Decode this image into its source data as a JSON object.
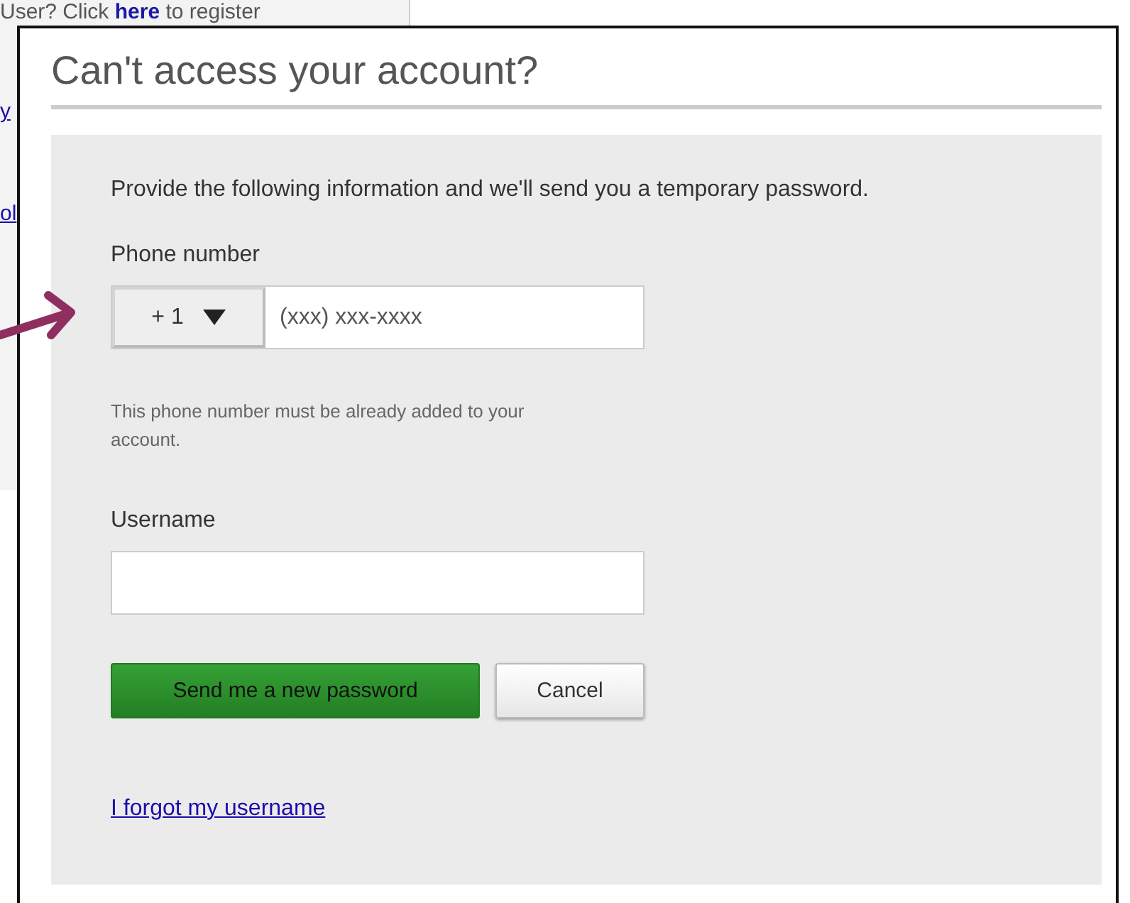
{
  "background_window": {
    "register_prompt": "User? Click ",
    "register_link": "here",
    "register_suffix": " to register",
    "link_fragments": [
      "y",
      "ol"
    ]
  },
  "dialog": {
    "title": "Can't access your account?",
    "intro": "Provide the following information and we'll send you a temporary password.",
    "phone": {
      "label": "Phone number",
      "country_code": "+ 1",
      "placeholder": "(xxx) xxx-xxxx",
      "hint": "This phone number must be already added to your account."
    },
    "username": {
      "label": "Username"
    },
    "buttons": [
      {
        "label": "Send me a new password",
        "kind": "primary"
      },
      {
        "label": "Cancel",
        "kind": "secondary"
      }
    ],
    "forgot_link": "I forgot my username"
  }
}
